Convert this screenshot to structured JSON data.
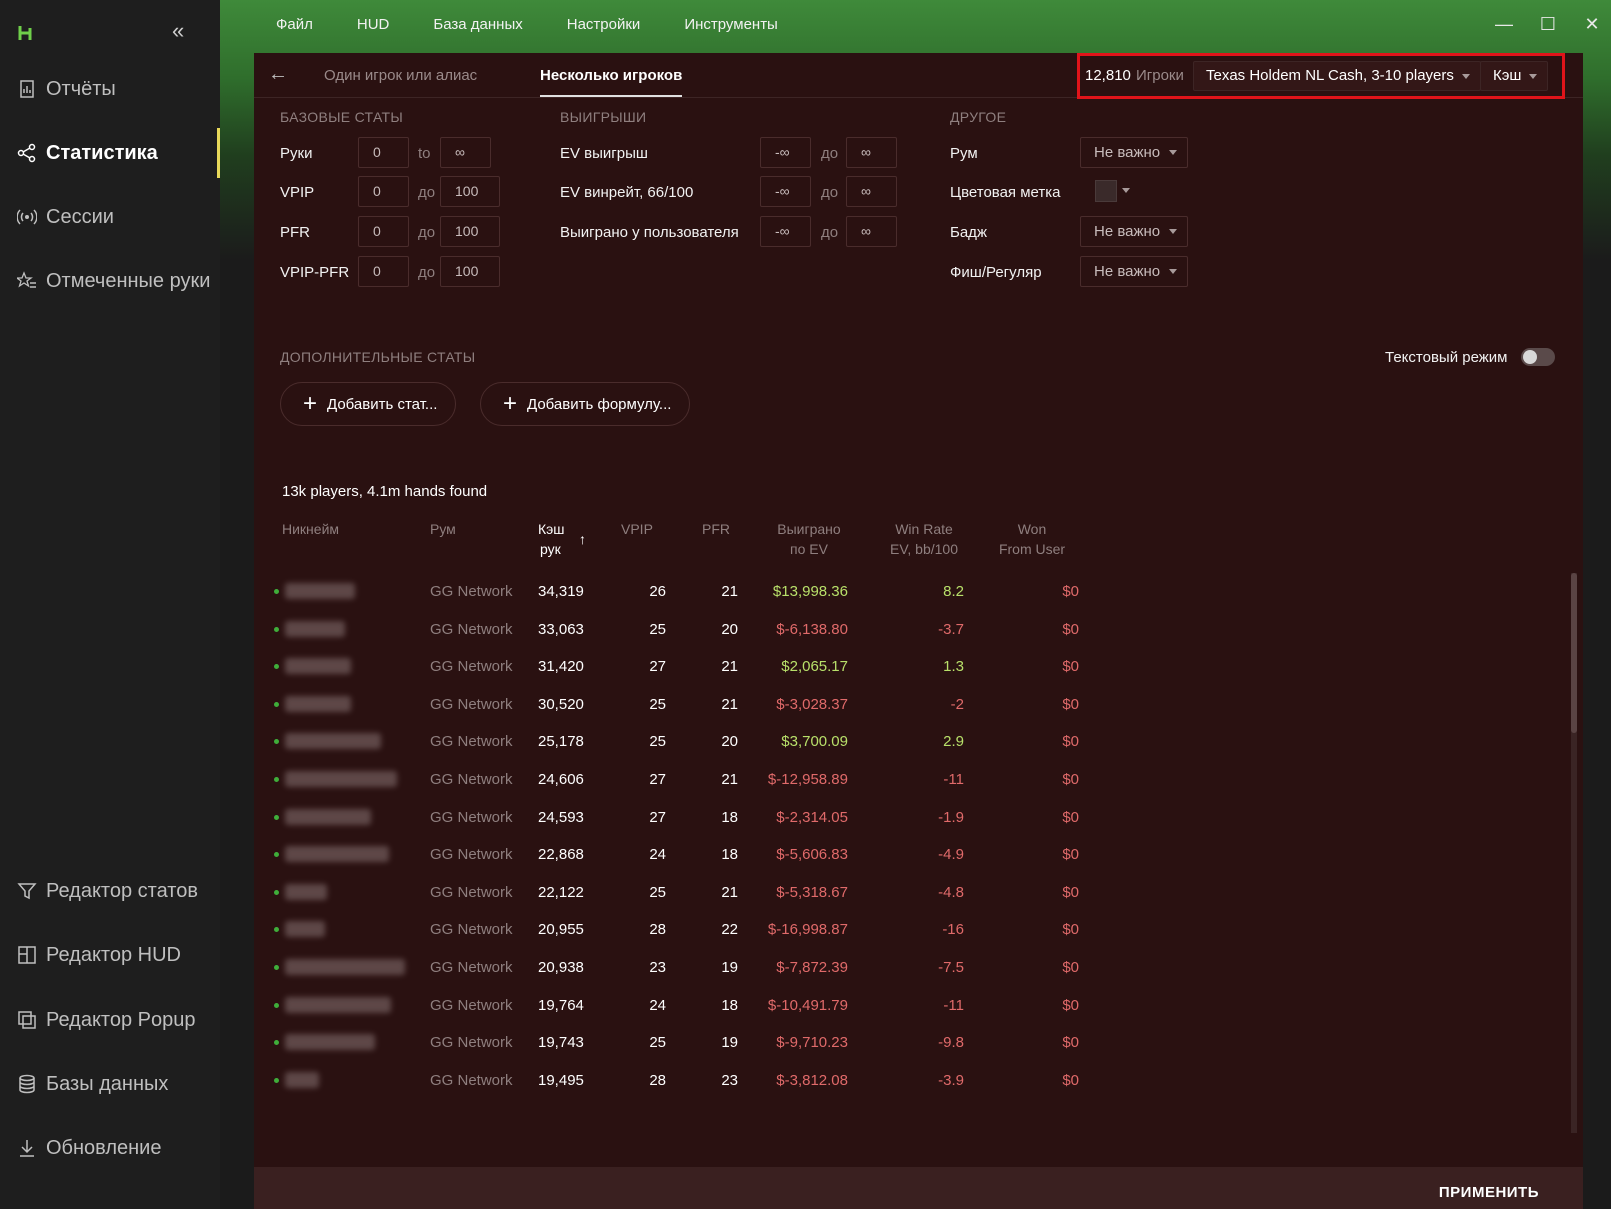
{
  "sidebar": {
    "collapse_icon": "«",
    "items_top": [
      {
        "label": "Отчёты",
        "icon": "report-icon"
      },
      {
        "label": "Статистика",
        "icon": "share-icon",
        "active": true
      },
      {
        "label": "Сессии",
        "icon": "broadcast-icon"
      },
      {
        "label": "Отмеченные руки",
        "icon": "star-list-icon"
      }
    ],
    "items_bottom": [
      {
        "label": "Редактор статов",
        "icon": "filter-icon"
      },
      {
        "label": "Редактор HUD",
        "icon": "hud-icon"
      },
      {
        "label": "Редактор Popup",
        "icon": "popup-icon"
      },
      {
        "label": "Базы данных",
        "icon": "database-icon"
      },
      {
        "label": "Обновление",
        "icon": "download-icon"
      }
    ]
  },
  "menu": [
    "Файл",
    "HUD",
    "База данных",
    "Настройки",
    "Инструменты"
  ],
  "window": {
    "minimize": "—",
    "maximize": "☐",
    "close": "✕"
  },
  "header": {
    "back": "←",
    "tab_single": "Один игрок или алиас",
    "tab_multi": "Несколько игроков",
    "player_count": "12,810",
    "player_count_label": "Игроки",
    "game_filter": "Texas Holdem NL Cash, 3-10 players",
    "type_filter": "Кэш"
  },
  "colors": {
    "accent_red_box": "#e0141a",
    "positive": "#b8e06a",
    "negative": "#e06a6a",
    "panel_bg": "#2a1111"
  },
  "base_stats": {
    "title": "БАЗОВЫЕ СТАТЫ",
    "rows": [
      {
        "label": "Руки",
        "min": "0",
        "sep": "to",
        "max": "∞"
      },
      {
        "label": "VPIP",
        "min": "0",
        "sep": "до",
        "max": "100"
      },
      {
        "label": "PFR",
        "min": "0",
        "sep": "до",
        "max": "100"
      },
      {
        "label": "VPIP-PFR",
        "min": "0",
        "sep": "до",
        "max": "100"
      }
    ]
  },
  "winnings": {
    "title": "ВЫИГРЫШИ",
    "rows": [
      {
        "label": "EV выигрыш",
        "min": "-∞",
        "sep": "до",
        "max": "∞"
      },
      {
        "label": "EV винрейт, 66/100",
        "min": "-∞",
        "sep": "до",
        "max": "∞"
      },
      {
        "label": "Выиграно у пользователя",
        "min": "-∞",
        "sep": "до",
        "max": "∞"
      }
    ]
  },
  "other": {
    "title": "ДРУГОЕ",
    "room_label": "Рум",
    "room_value": "Не важно",
    "color_label": "Цветовая метка",
    "badge_label": "Бадж",
    "badge_value": "Не важно",
    "fish_label": "Фиш/Регуляр",
    "fish_value": "Не важно"
  },
  "extra": {
    "title": "ДОПОЛНИТЕЛЬНЫЕ СТАТЫ",
    "text_mode_label": "Текстовый режим",
    "text_mode_on": false,
    "add_stat": "Добавить стат...",
    "add_formula": "Добавить формулу..."
  },
  "results": {
    "found": "13k players, 4.1m hands found",
    "columns": {
      "nick": "Никнейм",
      "room": "Рум",
      "hands_1": "Кэш",
      "hands_2": "рук",
      "sort_icon": "↑",
      "vpip": "VPIP",
      "pfr": "PFR",
      "won_1": "Выиграно",
      "won_2": "по EV",
      "wr_1": "Win Rate",
      "wr_2": "EV, bb/100",
      "wfu_1": "Won",
      "wfu_2": "From User"
    },
    "rows": [
      {
        "room": "GG Network",
        "hands": "34,319",
        "vpip": "26",
        "pfr": "21",
        "won": "$13,998.36",
        "wr": "8.2",
        "wfu": "$0",
        "pos": true
      },
      {
        "room": "GG Network",
        "hands": "33,063",
        "vpip": "25",
        "pfr": "20",
        "won": "$-6,138.80",
        "wr": "-3.7",
        "wfu": "$0",
        "pos": false
      },
      {
        "room": "GG Network",
        "hands": "31,420",
        "vpip": "27",
        "pfr": "21",
        "won": "$2,065.17",
        "wr": "1.3",
        "wfu": "$0",
        "pos": true
      },
      {
        "room": "GG Network",
        "hands": "30,520",
        "vpip": "25",
        "pfr": "21",
        "won": "$-3,028.37",
        "wr": "-2",
        "wfu": "$0",
        "pos": false
      },
      {
        "room": "GG Network",
        "hands": "25,178",
        "vpip": "25",
        "pfr": "20",
        "won": "$3,700.09",
        "wr": "2.9",
        "wfu": "$0",
        "pos": true
      },
      {
        "room": "GG Network",
        "hands": "24,606",
        "vpip": "27",
        "pfr": "21",
        "won": "$-12,958.89",
        "wr": "-11",
        "wfu": "$0",
        "pos": false
      },
      {
        "room": "GG Network",
        "hands": "24,593",
        "vpip": "27",
        "pfr": "18",
        "won": "$-2,314.05",
        "wr": "-1.9",
        "wfu": "$0",
        "pos": false
      },
      {
        "room": "GG Network",
        "hands": "22,868",
        "vpip": "24",
        "pfr": "18",
        "won": "$-5,606.83",
        "wr": "-4.9",
        "wfu": "$0",
        "pos": false
      },
      {
        "room": "GG Network",
        "hands": "22,122",
        "vpip": "25",
        "pfr": "21",
        "won": "$-5,318.67",
        "wr": "-4.8",
        "wfu": "$0",
        "pos": false
      },
      {
        "room": "GG Network",
        "hands": "20,955",
        "vpip": "28",
        "pfr": "22",
        "won": "$-16,998.87",
        "wr": "-16",
        "wfu": "$0",
        "pos": false
      },
      {
        "room": "GG Network",
        "hands": "20,938",
        "vpip": "23",
        "pfr": "19",
        "won": "$-7,872.39",
        "wr": "-7.5",
        "wfu": "$0",
        "pos": false
      },
      {
        "room": "GG Network",
        "hands": "19,764",
        "vpip": "24",
        "pfr": "18",
        "won": "$-10,491.79",
        "wr": "-11",
        "wfu": "$0",
        "pos": false
      },
      {
        "room": "GG Network",
        "hands": "19,743",
        "vpip": "25",
        "pfr": "19",
        "won": "$-9,710.23",
        "wr": "-9.8",
        "wfu": "$0",
        "pos": false
      },
      {
        "room": "GG Network",
        "hands": "19,495",
        "vpip": "28",
        "pfr": "23",
        "won": "$-3,812.08",
        "wr": "-3.9",
        "wfu": "$0",
        "pos": false
      }
    ]
  },
  "footer": {
    "apply": "ПРИМЕНИТЬ"
  }
}
